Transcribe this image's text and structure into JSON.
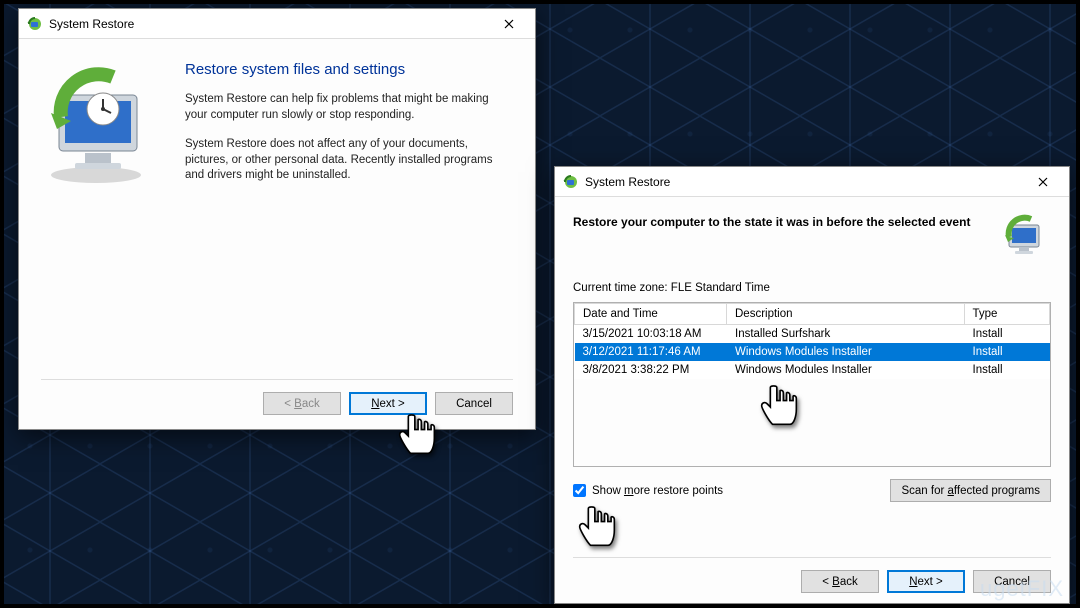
{
  "dialog1": {
    "title": "System Restore",
    "heading": "Restore system files and settings",
    "para1": "System Restore can help fix problems that might be making your computer run slowly or stop responding.",
    "para2": "System Restore does not affect any of your documents, pictures, or other personal data. Recently installed programs and drivers might be uninstalled.",
    "buttons": {
      "back": "< Back",
      "next": "Next >",
      "cancel": "Cancel"
    }
  },
  "dialog2": {
    "title": "System Restore",
    "heading": "Restore your computer to the state it was in before the selected event",
    "timezone_label": "Current time zone: FLE Standard Time",
    "columns": {
      "datetime": "Date and Time",
      "description": "Description",
      "type": "Type"
    },
    "rows": [
      {
        "datetime": "3/15/2021 10:03:18 AM",
        "description": "Installed Surfshark",
        "type": "Install",
        "selected": false
      },
      {
        "datetime": "3/12/2021 11:17:46 AM",
        "description": "Windows Modules Installer",
        "type": "Install",
        "selected": true
      },
      {
        "datetime": "3/8/2021 3:38:22 PM",
        "description": "Windows Modules Installer",
        "type": "Install",
        "selected": false
      }
    ],
    "checkbox_label": "Show more restore points",
    "checkbox_checked": true,
    "scan_button": "Scan for affected programs",
    "buttons": {
      "back": "< Back",
      "next": "Next >",
      "cancel": "Cancel"
    }
  },
  "watermark": "ugetFIX"
}
